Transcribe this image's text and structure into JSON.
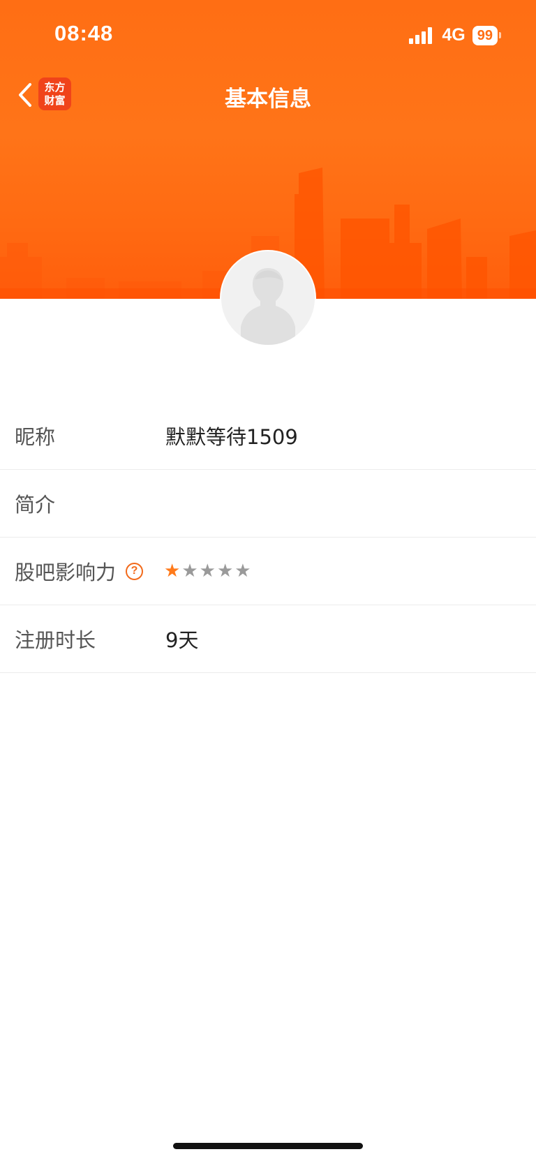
{
  "status_bar": {
    "time": "08:48",
    "network": "4G",
    "battery": "99"
  },
  "nav": {
    "title": "基本信息",
    "app_logo_line1": "东方",
    "app_logo_line2": "财富",
    "back_icon": "chevron-left-icon"
  },
  "profile": {
    "avatar_icon": "default-user-avatar-icon"
  },
  "info": {
    "nickname_label": "昵称",
    "nickname_value": "默默等待1509",
    "intro_label": "简介",
    "intro_value": "",
    "influence_label": "股吧影响力",
    "influence_help_icon": "question-circle-icon",
    "influence_help_glyph": "?",
    "influence_rating": 1,
    "influence_max": 5,
    "star_glyph": "★",
    "register_label": "注册时长",
    "register_value": "9天"
  },
  "colors": {
    "header_orange": "#ff6e14",
    "accent": "#f26a1b",
    "star_active": "#ff7a1a",
    "star_inactive": "#9a9a9a"
  }
}
